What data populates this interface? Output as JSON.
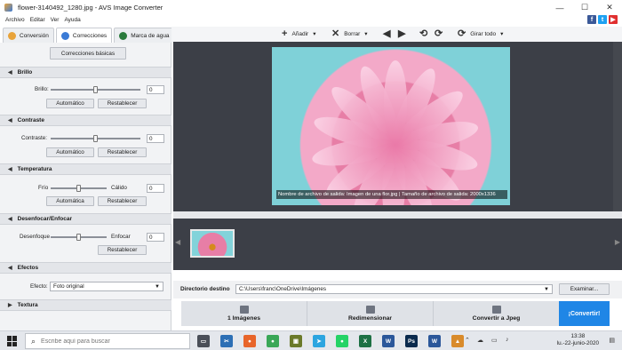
{
  "window": {
    "title": "flower-3140492_1280.jpg - AVS Image Converter",
    "minimize": "—",
    "maximize": "☐",
    "close": "✕"
  },
  "menu": [
    "Archivo",
    "Editar",
    "Ver",
    "Ayuda"
  ],
  "social": [
    {
      "icon": "facebook-icon",
      "glyph": "f",
      "color": "#3b5998"
    },
    {
      "icon": "twitter-icon",
      "glyph": "t",
      "color": "#1da1f2"
    },
    {
      "icon": "youtube-icon",
      "glyph": "▶",
      "color": "#e02f2f"
    }
  ],
  "tabs": [
    {
      "label": "Conversión",
      "color": "#e8a33a"
    },
    {
      "label": "Correcciones",
      "color": "#3b7bd6"
    },
    {
      "label": "Marca de agua",
      "color": "#2a7b3c"
    }
  ],
  "toolbar": {
    "add": "Añadir",
    "delete": "Borrar",
    "rotate": "Girar todo"
  },
  "left": {
    "basic_corrections": "Correcciones básicas",
    "brightness": {
      "title": "Brillo",
      "label": "Brillo:",
      "value": "0",
      "auto": "Automático",
      "reset": "Restablecer",
      "level": 0.5
    },
    "contrast": {
      "title": "Contraste",
      "label": "Contraste:",
      "value": "0",
      "auto": "Automático",
      "reset": "Restablecer",
      "level": 0.5
    },
    "temperature": {
      "title": "Temperatura",
      "left": "Frío",
      "right": "Cálido",
      "value": "0",
      "auto": "Automática",
      "reset": "Restablecer",
      "level": 0.5
    },
    "blur": {
      "title": "Desenfocar/Enfocar",
      "left": "Desenfoque",
      "right": "Enfocar",
      "value": "0",
      "reset": "Restablecer",
      "level": 0.5
    },
    "effects": {
      "title": "Efectos",
      "label": "Efecto:",
      "value": "Foto original"
    },
    "texture": {
      "title": "Textura"
    }
  },
  "preview": {
    "caption": "Nombre de archivo de salida: Imagen de una flor.jpg | Tamaño de archivo de salida: 2000x1336"
  },
  "destination": {
    "label": "Directorio destino",
    "path": "C:\\Users\\franc\\OneDrive\\Imágenes",
    "browse": "Examinar..."
  },
  "steps": [
    {
      "label": "1 Imágenes",
      "icon": "images-icon"
    },
    {
      "label": "Redimensionar",
      "icon": "resize-icon"
    },
    {
      "label": "Convertir a Jpeg",
      "icon": "file-convert-icon"
    }
  ],
  "convert_button": "¡Convertir!",
  "taskbar": {
    "search_placeholder": "Escribe aquí para buscar",
    "time": "13:38",
    "date": "lu.-22-junio-2020",
    "apps": [
      {
        "icon": "task-view-icon",
        "glyph": "▭",
        "color": "#4a4f58"
      },
      {
        "icon": "snip-icon",
        "glyph": "✂",
        "color": "#2c6fb5"
      },
      {
        "icon": "firefox-icon",
        "glyph": "●",
        "color": "#e8652a"
      },
      {
        "icon": "chrome-icon",
        "glyph": "●",
        "color": "#3aa757"
      },
      {
        "icon": "app-icon",
        "glyph": "▣",
        "color": "#6b7a2a"
      },
      {
        "icon": "telegram-icon",
        "glyph": "➤",
        "color": "#2ca5e0"
      },
      {
        "icon": "whatsapp-icon",
        "glyph": "●",
        "color": "#25d366"
      },
      {
        "icon": "excel-icon",
        "glyph": "X",
        "color": "#1d7044"
      },
      {
        "icon": "word-icon",
        "glyph": "W",
        "color": "#2b579a"
      },
      {
        "icon": "photoshop-icon",
        "glyph": "Ps",
        "color": "#0a2a4d"
      },
      {
        "icon": "word-doc-icon",
        "glyph": "W",
        "color": "#2b579a"
      },
      {
        "icon": "avs-icon",
        "glyph": "▲",
        "color": "#d98b2b"
      }
    ]
  }
}
